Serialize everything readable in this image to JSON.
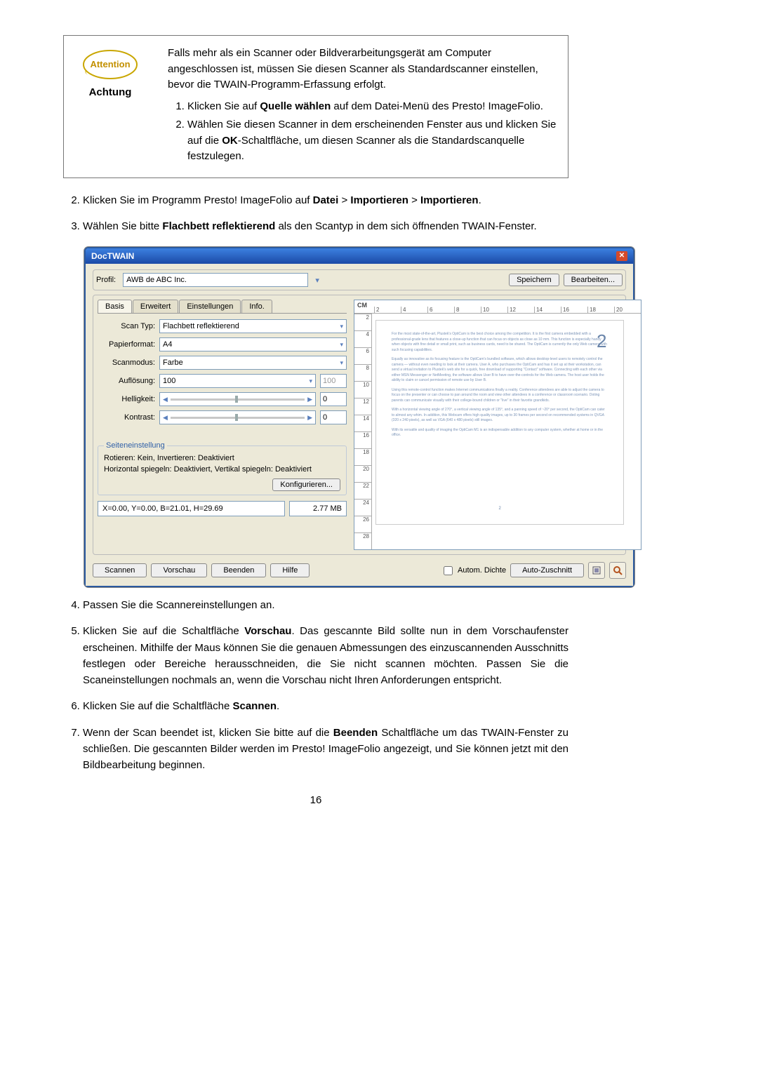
{
  "attention": {
    "label": "Achtung",
    "logo_text": "Attention",
    "paragraph": "Falls mehr als ein Scanner oder Bildverarbeitungsgerät am Computer angeschlossen ist, müssen Sie diesen Scanner als Standardscanner einstellen, bevor die TWAIN-Programm-Erfassung erfolgt.",
    "items": [
      {
        "prefix": "Klicken Sie auf ",
        "bold": "Quelle wählen",
        "suffix": " auf dem Datei-Menü des Presto! ImageFolio."
      },
      {
        "prefix": "Wählen Sie diesen Scanner in dem erscheinenden Fenster aus und klicken Sie auf die ",
        "bold": "OK",
        "suffix": "-Schaltfläche, um diesen Scanner als die Standardscanquelle festzulegen."
      }
    ]
  },
  "steps": {
    "s2": {
      "t1": "Klicken Sie im Programm Presto! ImageFolio auf ",
      "b1": "Datei",
      "sep1": " > ",
      "b2": "Importieren",
      "sep2": " > ",
      "b3": "Importieren",
      "tail": "."
    },
    "s3": {
      "t1": "Wählen Sie bitte ",
      "b1": "Flachbett reflektierend",
      "t2": " als den Scantyp in dem sich öffnenden TWAIN-Fenster."
    },
    "s4": "Passen Sie die Scanner­einstellungen an.",
    "s5": {
      "t1": "Klicken Sie auf die Schaltfläche ",
      "b1": "Vorschau",
      "t2": ". Das gescannte Bild sollte nun in dem Vorschaufenster erscheinen. Mithilfe der Maus können Sie die genauen Abmessungen des einzuscannenden Ausschnitts festlegen oder Bereiche herausschneiden, die Sie nicht scannen möchten. Passen Sie die Scaneinstellungen nochmals an, wenn die Vorschau nicht Ihren Anforderungen entspricht."
    },
    "s6": {
      "t1": "Klicken Sie auf die Schaltfläche ",
      "b1": "Scannen",
      "t2": "."
    },
    "s7": {
      "t1": "Wenn der Scan beendet ist, klicken Sie bitte auf die ",
      "b1": "Beenden",
      "t2": " Schaltfläche um das TWAIN-Fenster zu schließen. Die gescannten Bilder werden im Presto! ImageFolio angezeigt, und Sie können jetzt mit den Bildbearbeitung beginnen."
    }
  },
  "twain": {
    "title": "DocTWAIN",
    "profile_label": "Profil:",
    "profile_value": "AWB de ABC Inc.",
    "save": "Speichern",
    "edit": "Bearbeiten...",
    "tabs": [
      "Basis",
      "Erweitert",
      "Einstellungen",
      "Info."
    ],
    "rows": {
      "scan_type": {
        "label": "Scan Typ:",
        "value": "Flachbett reflektierend"
      },
      "paper": {
        "label": "Papierformat:",
        "value": "A4"
      },
      "mode": {
        "label": "Scanmodus:",
        "value": "Farbe"
      },
      "resolution": {
        "label": "Auflösung:",
        "value": "100",
        "disp": "100"
      },
      "brightness": {
        "label": "Helligkeit:",
        "value": "0"
      },
      "contrast": {
        "label": "Kontrast:",
        "value": "0"
      }
    },
    "side_section": "Seiteneinstellung",
    "side_line1": "Rotieren: Kein, Invertieren: Deaktiviert",
    "side_line2": "Horizontal spiegeln: Deaktiviert, Vertikal spiegeln: Deaktiviert",
    "configure": "Konfigurieren...",
    "ruler_unit": "CM",
    "h_ticks": [
      "2",
      "4",
      "6",
      "8",
      "10",
      "12",
      "14",
      "16",
      "18",
      "20"
    ],
    "v_ticks": [
      "2",
      "4",
      "6",
      "8",
      "10",
      "12",
      "14",
      "16",
      "18",
      "20",
      "22",
      "24",
      "26",
      "28"
    ],
    "preview_big": "2",
    "preview_page": "2",
    "status_coords": "X=0.00, Y=0.00, B=21.01, H=29.69",
    "status_size": "2.77 MB",
    "btn_scan": "Scannen",
    "btn_preview": "Vorschau",
    "btn_exit": "Beenden",
    "btn_help": "Hilfe",
    "auto_density": "Autom. Dichte",
    "auto_crop": "Auto-Zuschnitt"
  },
  "page_number": "16"
}
